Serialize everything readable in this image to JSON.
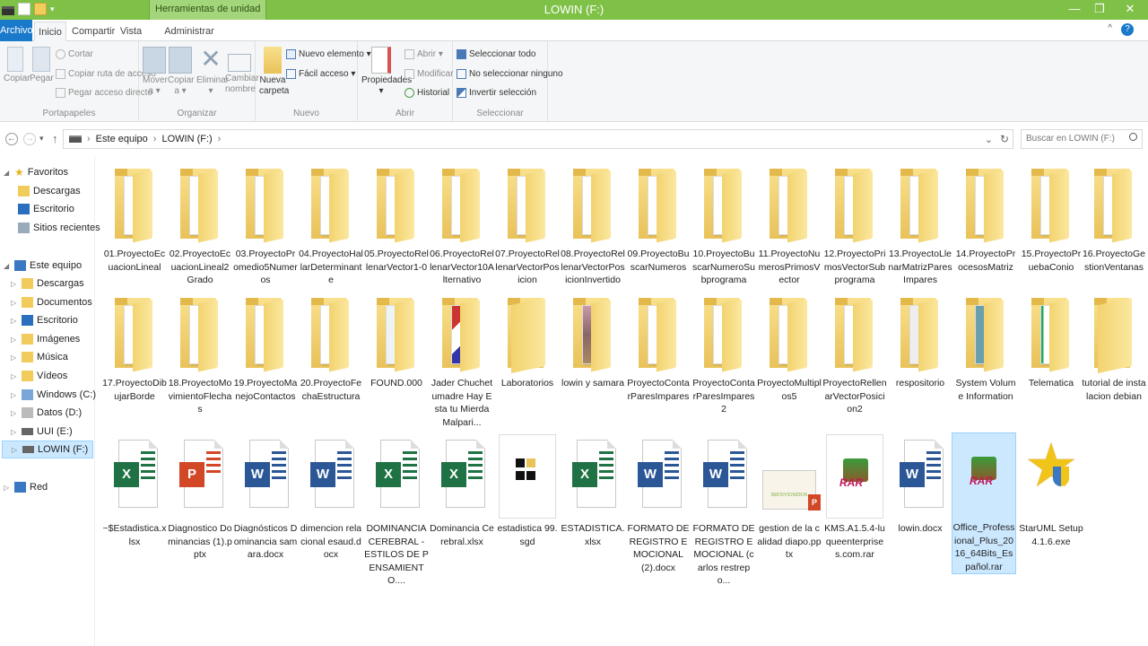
{
  "window": {
    "title": "LOWIN (F:)",
    "tool_tab": "Herramientas de unidad",
    "minimize": "—",
    "restore": "❐",
    "close": "✕"
  },
  "tabs": {
    "archivo": "Archivo",
    "inicio": "Inicio",
    "compartir": "Compartir",
    "vista": "Vista",
    "administrar": "Administrar",
    "help": "?"
  },
  "ribbon": {
    "portapapeles": {
      "label": "Portapapeles",
      "copiar": "Copiar",
      "pegar": "Pegar",
      "cortar": "Cortar",
      "copiar_ruta": "Copiar ruta de acceso",
      "pegar_acceso": "Pegar acceso directo"
    },
    "organizar": {
      "label": "Organizar",
      "mover": "Mover",
      "mover2": "a ▾",
      "copiar": "Copiar",
      "copiar2": "a ▾",
      "eliminar": "Eliminar",
      "eliminar2": "▾",
      "cambiar": "Cambiar",
      "cambiar2": "nombre"
    },
    "nuevo": {
      "label": "Nuevo",
      "nueva": "Nueva",
      "carpeta": "carpeta",
      "nuevo_elemento": "Nuevo elemento ▾",
      "facil_acceso": "Fácil acceso ▾"
    },
    "abrir": {
      "label": "Abrir",
      "propiedades": "Propiedades",
      "propiedades2": "▾",
      "abrir": "Abrir ▾",
      "modificar": "Modificar",
      "historial": "Historial"
    },
    "seleccionar": {
      "label": "Seleccionar",
      "todo": "Seleccionar todo",
      "ninguno": "No seleccionar ninguno",
      "invertir": "Invertir selección"
    }
  },
  "address": {
    "back": "←",
    "forward": "→",
    "recent": "▾",
    "up": "↑",
    "path_1": "Este equipo",
    "path_2": "LOWIN (F:)",
    "sep": "›",
    "dropdown": "⌄",
    "refresh": "↻",
    "search_placeholder": "Buscar en LOWIN (F:)"
  },
  "sidebar": {
    "favoritos": "Favoritos",
    "fav_items": [
      "Descargas",
      "Escritorio",
      "Sitios recientes"
    ],
    "este_equipo": "Este equipo",
    "pc_items": [
      "Descargas",
      "Documentos",
      "Escritorio",
      "Imágenes",
      "Música",
      "Vídeos",
      "Windows (C:)",
      "Datos (D:)",
      "UUI (E:)",
      "LOWIN (F:)"
    ],
    "red": "Red"
  },
  "items_row1": [
    "01.ProyectoEcuacionLineal",
    "02.ProyectoEcuacionLineal2Grado",
    "03.ProyectoPromedio5Numeros",
    "04.ProyectoHallarDeterminante",
    "05.ProyectoRellenarVector1-0",
    "06.ProyectoRellenarVector10Alternativo",
    "07.ProyectoRellenarVectorPosicion",
    "08.ProyectoRellenarVectorPosicionInvertido",
    "09.ProyectoBuscarNumeros",
    "10.ProyectoBuscarNumeroSubprograma",
    "11.ProyectoNumerosPrimosVector",
    "12.ProyectoPrimosVectorSubprograma",
    "13.ProyectoLlenarMatrizParesImpares",
    "14.ProyectoProcesosMatriz",
    "15.ProyectoPruebaConio",
    "16.ProyectoGestionVentanas"
  ],
  "items_row2": [
    "17.ProyectoDibujarBorde",
    "18.ProyectoMovimientoFlechas",
    "19.ProyectoManejoContactos",
    "20.ProyectoFechaEstructura",
    "FOUND.000",
    "Jader Chuchetumadre Hay Esta tu Mierda Malpari...",
    "Laboratorios",
    "lowin y samara",
    "ProyectoContarParesImpares",
    "ProyectoContarParesImpares2",
    "ProyectoMultiplos5",
    "ProyectoRellenarVectorPosicion2",
    "respositorio",
    "System Volume Information",
    "Telematica",
    "tutorial de instalacion debian"
  ],
  "items_row3": [
    "~$Estadistica.xlsx",
    "Diagnostico Dominancias (1).pptx",
    "Diagnósticos Dominancia samara.docx",
    "dimencion relacional esaud.docx",
    "DOMINANCIA CEREBRAL - ESTILOS DE PENSAMIENTO....",
    "Dominancia Cerebral.xlsx",
    "estadistica 99.sgd",
    "ESTADISTICA.xlsx",
    "FORMATO DE REGISTRO EMOCIONAL (2).docx",
    "FORMATO DE REGISTRO EMOCIONAL (carlos restrepo...",
    "gestion de la calidad diapo.pptx",
    "KMS.A1.5.4-luqueenterprises.com.rar",
    "lowin.docx",
    "Office_Professional_Plus_2016_64Bits_Español.rar",
    "StarUML Setup 4.1.6.exe"
  ],
  "badges": {
    "excel": "X",
    "ppt": "P",
    "word": "W",
    "rar": "RAR",
    "bienvenidos": "BIENVENIDOS"
  },
  "colors": {
    "titlebar": "#7fc147",
    "accent": "#1979ca",
    "excel": "#1f7244",
    "word": "#2b5797",
    "ppt": "#d24726",
    "selection": "#cce8ff"
  }
}
